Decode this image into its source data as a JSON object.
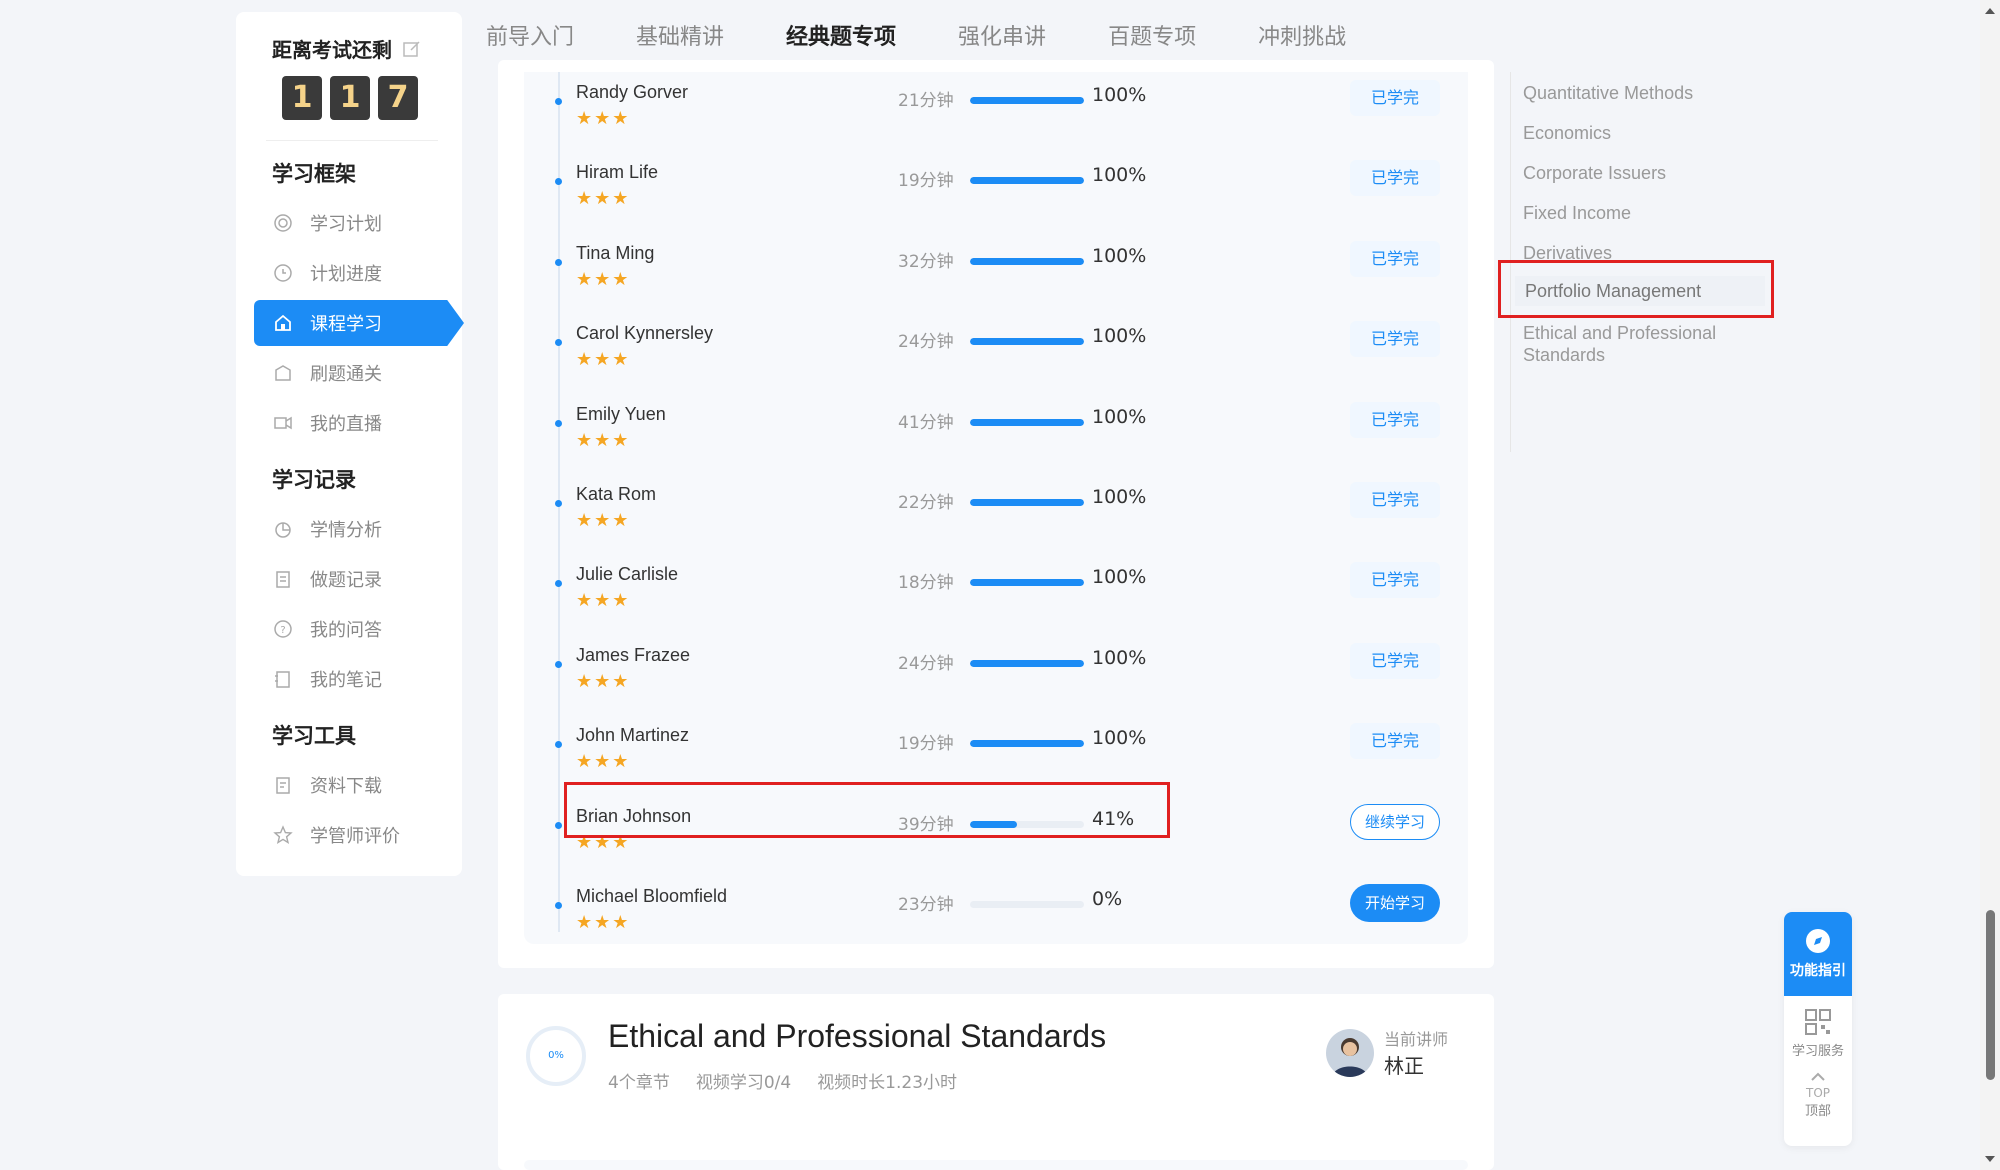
{
  "topnav": {
    "tabs": [
      {
        "label": "前导入门"
      },
      {
        "label": "基础精讲"
      },
      {
        "label": "经典题专项"
      },
      {
        "label": "强化串讲"
      },
      {
        "label": "百题专项"
      },
      {
        "label": "冲刺挑战"
      }
    ],
    "active_index": 2
  },
  "sidebar": {
    "countdown_title": "距离考试还剩",
    "digits": [
      "1",
      "1",
      "7"
    ],
    "sections": [
      {
        "title": "学习框架",
        "items": [
          "学习计划",
          "计划进度",
          "课程学习",
          "刷题通关",
          "我的直播"
        ]
      },
      {
        "title": "学习记录",
        "items": [
          "学情分析",
          "做题记录",
          "我的问答",
          "我的笔记"
        ]
      },
      {
        "title": "学习工具",
        "items": [
          "资料下载",
          "学管师评价"
        ]
      }
    ],
    "active_item": "课程学习"
  },
  "lessons": [
    {
      "name": "Randy Gorver",
      "duration": "21分钟",
      "progress": 100,
      "pct_label": "100%",
      "action": "已学完",
      "state": "done"
    },
    {
      "name": "Hiram Life",
      "duration": "19分钟",
      "progress": 100,
      "pct_label": "100%",
      "action": "已学完",
      "state": "done"
    },
    {
      "name": "Tina Ming",
      "duration": "32分钟",
      "progress": 100,
      "pct_label": "100%",
      "action": "已学完",
      "state": "done"
    },
    {
      "name": "Carol Kynnersley",
      "duration": "24分钟",
      "progress": 100,
      "pct_label": "100%",
      "action": "已学完",
      "state": "done"
    },
    {
      "name": "Emily Yuen",
      "duration": "41分钟",
      "progress": 100,
      "pct_label": "100%",
      "action": "已学完",
      "state": "done"
    },
    {
      "name": "Kata Rom",
      "duration": "22分钟",
      "progress": 100,
      "pct_label": "100%",
      "action": "已学完",
      "state": "done"
    },
    {
      "name": "Julie Carlisle",
      "duration": "18分钟",
      "progress": 100,
      "pct_label": "100%",
      "action": "已学完",
      "state": "done"
    },
    {
      "name": "James Frazee",
      "duration": "24分钟",
      "progress": 100,
      "pct_label": "100%",
      "action": "已学完",
      "state": "done"
    },
    {
      "name": "John Martinez",
      "duration": "19分钟",
      "progress": 100,
      "pct_label": "100%",
      "action": "已学完",
      "state": "done"
    },
    {
      "name": "Brian Johnson",
      "duration": "39分钟",
      "progress": 41,
      "pct_label": "41%",
      "action": "继续学习",
      "state": "continue"
    },
    {
      "name": "Michael Bloomfield",
      "duration": "23分钟",
      "progress": 0,
      "pct_label": "0%",
      "action": "开始学习",
      "state": "start"
    }
  ],
  "stars": "★★★",
  "chapter_nav": {
    "items": [
      "Quantitative Methods",
      "Economics",
      "Corporate Issuers",
      "Fixed Income",
      "Derivatives",
      "Portfolio Management",
      "Ethical and Professional Standards"
    ],
    "active": "Portfolio Management"
  },
  "next_chapter": {
    "ring_label": "0%",
    "title": "Ethical and Professional Standards",
    "meta": [
      "4个章节",
      "视频学习0/4",
      "视频时长1.23小时"
    ],
    "teacher_label": "当前讲师",
    "teacher_name": "林正"
  },
  "float_tools": {
    "guide": "功能指引",
    "service": "学习服务",
    "top_en": "TOP",
    "top": "顶部"
  },
  "colors": {
    "accent": "#1c8cf5",
    "highlight": "#e02020",
    "star": "#f5a623"
  }
}
